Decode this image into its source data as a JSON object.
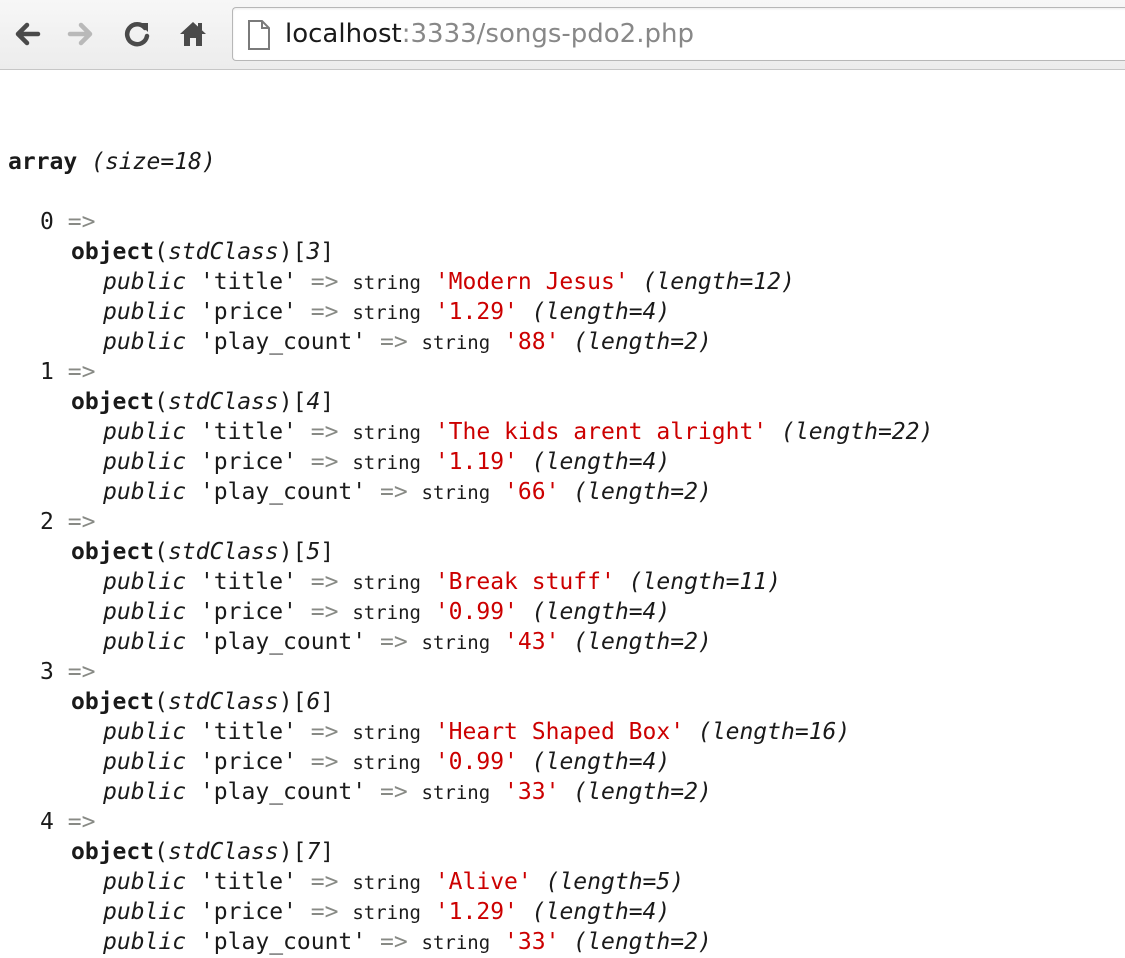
{
  "browser": {
    "url_host": "localhost",
    "url_rest": ":3333/songs-pdo2.php"
  },
  "dump": {
    "header_kw": "array",
    "header_size": "(size=18)",
    "arrow": "=>",
    "object_kw": "object",
    "class_name": "stdClass",
    "visibility": "public",
    "type_name": "string",
    "items": [
      {
        "index": "0",
        "obj_id": "3",
        "props": [
          {
            "key": "'title'",
            "value": "'Modern Jesus'",
            "length": "(length=12)"
          },
          {
            "key": "'price'",
            "value": "'1.29'",
            "length": "(length=4)"
          },
          {
            "key": "'play_count'",
            "value": "'88'",
            "length": "(length=2)"
          }
        ]
      },
      {
        "index": "1",
        "obj_id": "4",
        "props": [
          {
            "key": "'title'",
            "value": "'The kids arent alright'",
            "length": "(length=22)"
          },
          {
            "key": "'price'",
            "value": "'1.19'",
            "length": "(length=4)"
          },
          {
            "key": "'play_count'",
            "value": "'66'",
            "length": "(length=2)"
          }
        ]
      },
      {
        "index": "2",
        "obj_id": "5",
        "props": [
          {
            "key": "'title'",
            "value": "'Break stuff'",
            "length": "(length=11)"
          },
          {
            "key": "'price'",
            "value": "'0.99'",
            "length": "(length=4)"
          },
          {
            "key": "'play_count'",
            "value": "'43'",
            "length": "(length=2)"
          }
        ]
      },
      {
        "index": "3",
        "obj_id": "6",
        "props": [
          {
            "key": "'title'",
            "value": "'Heart Shaped Box'",
            "length": "(length=16)"
          },
          {
            "key": "'price'",
            "value": "'0.99'",
            "length": "(length=4)"
          },
          {
            "key": "'play_count'",
            "value": "'33'",
            "length": "(length=2)"
          }
        ]
      },
      {
        "index": "4",
        "obj_id": "7",
        "props": [
          {
            "key": "'title'",
            "value": "'Alive'",
            "length": "(length=5)"
          },
          {
            "key": "'price'",
            "value": "'1.29'",
            "length": "(length=4)"
          },
          {
            "key": "'play_count'",
            "value": "'33'",
            "length": "(length=2)"
          }
        ]
      }
    ]
  }
}
